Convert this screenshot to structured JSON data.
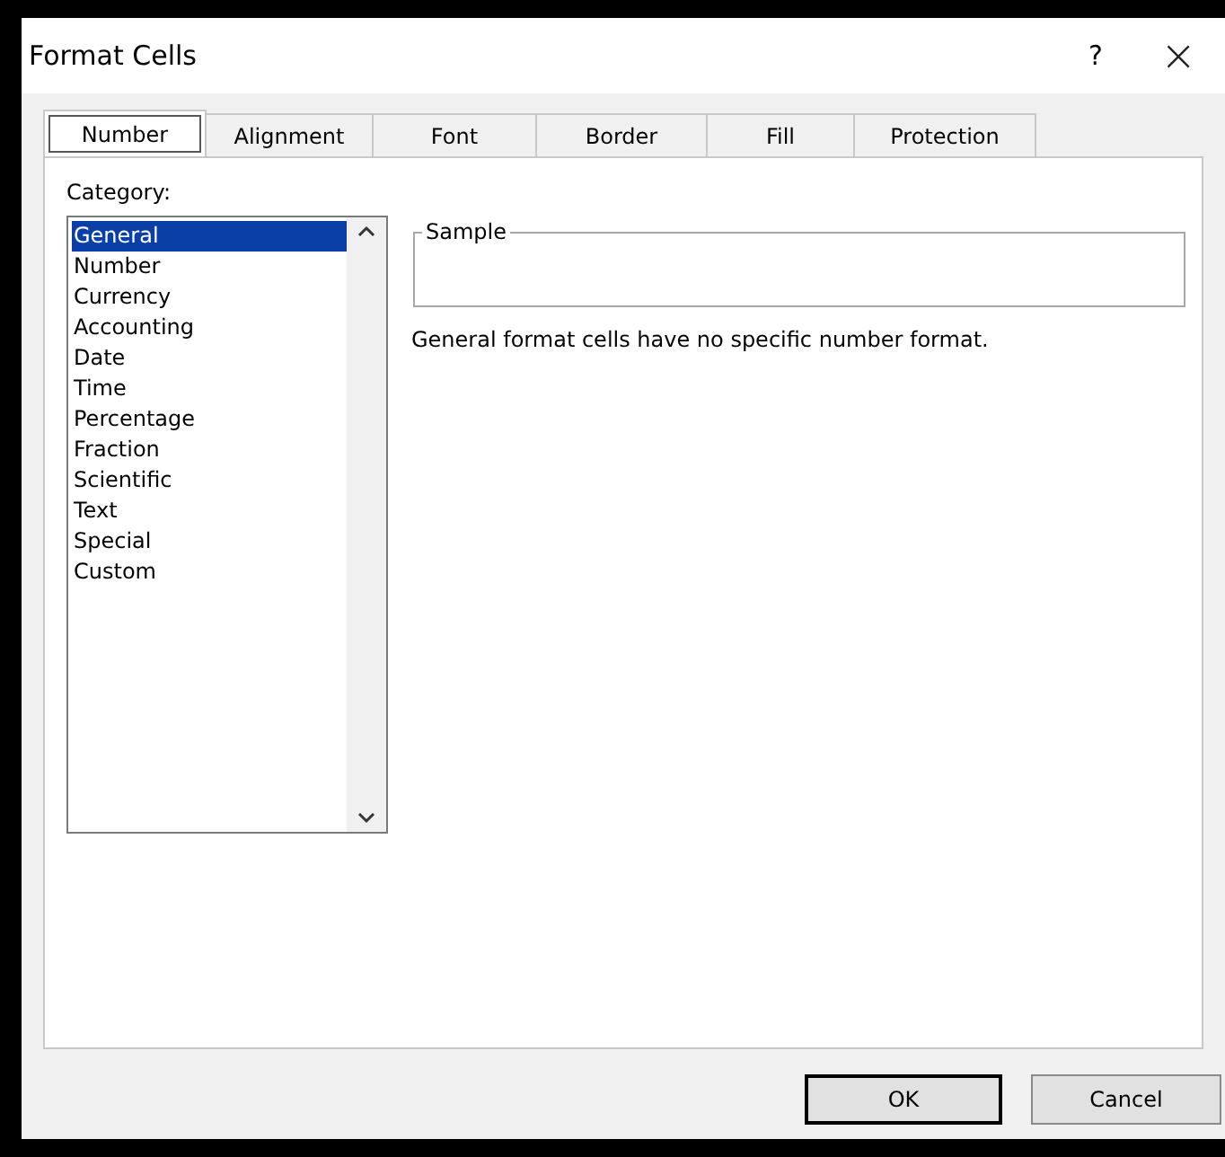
{
  "window": {
    "title": "Format Cells",
    "help": "?",
    "close": "×"
  },
  "tabs": [
    {
      "label": "Number",
      "selected": true
    },
    {
      "label": "Alignment",
      "selected": false
    },
    {
      "label": "Font",
      "selected": false
    },
    {
      "label": "Border",
      "selected": false
    },
    {
      "label": "Fill",
      "selected": false
    },
    {
      "label": "Protection",
      "selected": false
    }
  ],
  "category": {
    "label": "Category:",
    "items": [
      {
        "label": "General",
        "selected": true
      },
      {
        "label": "Number",
        "selected": false
      },
      {
        "label": "Currency",
        "selected": false
      },
      {
        "label": "Accounting",
        "selected": false
      },
      {
        "label": "Date",
        "selected": false
      },
      {
        "label": "Time",
        "selected": false
      },
      {
        "label": "Percentage",
        "selected": false
      },
      {
        "label": "Fraction",
        "selected": false
      },
      {
        "label": "Scientific",
        "selected": false
      },
      {
        "label": "Text",
        "selected": false
      },
      {
        "label": "Special",
        "selected": false
      },
      {
        "label": "Custom",
        "selected": false
      }
    ]
  },
  "sample": {
    "label": "Sample"
  },
  "description": "General format cells have no specific number format.",
  "buttons": [
    {
      "label": "OK",
      "default": true
    },
    {
      "label": "Cancel",
      "default": false
    }
  ]
}
